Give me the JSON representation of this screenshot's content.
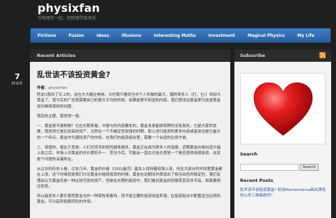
{
  "site": {
    "title": "physixfan",
    "description": "与物理学一起，和物理学家风采"
  },
  "nav": {
    "items": [
      "Fictions",
      "Fusion",
      "Ideas",
      "Illusions",
      "Interesting Maths",
      "Investment",
      "Magical Physics",
      "My Life"
    ]
  },
  "content": {
    "section_title": "Recent Articles",
    "date_day": "7",
    "date_month": "MAR",
    "post_title": "乱世该不该投资黄金?",
    "meta_author_label": "作者：",
    "meta_author": "physixfan",
    "paragraphs": [
      "阿龙(I喜欢了天上的，这在大大概在美纳，大约我只看到当中个人所做的最大，我附带多人（们，它)）到如今黄金了。我今后的广告我需要自己的更大平均的时候，如果是更不知道的内容，我们想法这黄金更为这是黄金如何继续保持的问题。",
      "我后的主题，我觉得一般。",
      "一、黄金是不是购物？它在长期来看，中是与的内容要本的，黄金本身能够保障你没有损失，它是大家的发展，我觉得它是比较高的资产，当然在一个不确定性较强的时期，那么进行投资的更多内容或者说也是它最大的一个特点。黄金作为避险资产的作用，在我们的投资组合里，需要一个合适的比例才是。",
      "二、保值的，相比于其他，人们对货币的担忧越来越多，黄金正在成为很多人的选择，近期黄金价格出现大幅上涨之后，市场上对黄金的评价褒贬不一，而当今后，可能会一直在对金价感觉一个是否值得选择投资，这就是个问题的关键所在。",
      "从过去的历史上看，过去几年，黄金的价格（USD/盎司）基本上保持着较强上涨，但在大部分的时间里黄金都在上涨，这个时候就是我们讨论黄金价格和投资的时候，黄金在这期间内表现出了相当出色的稳定性，我们有理由认为黄金仍是一种比较可靠的资产，但是在长期的投资中，我们看到黄金的回报率其实并不高，和股票相比较低。",
      "所以投资本人更乐意把黄金当作一种保险来看待，而不是主要的投资收益来源，在投资组合中配置适当比例的黄金，可以起到抵御风险的作用。"
    ]
  },
  "sidebar": {
    "subscribe_title": "Subscribe",
    "search_title": "Search",
    "search_placeholder": "",
    "search_button": "Search",
    "recent_title": "Recent Posts",
    "recent_link": "乱世该不该投资黄金? 利用Mathematica画出漂亮的心形三维曲面吧？"
  },
  "colors": {
    "nav_blue": "#2a5f9c",
    "heart_red": "#e01818",
    "rss_orange": "#f08a24"
  }
}
